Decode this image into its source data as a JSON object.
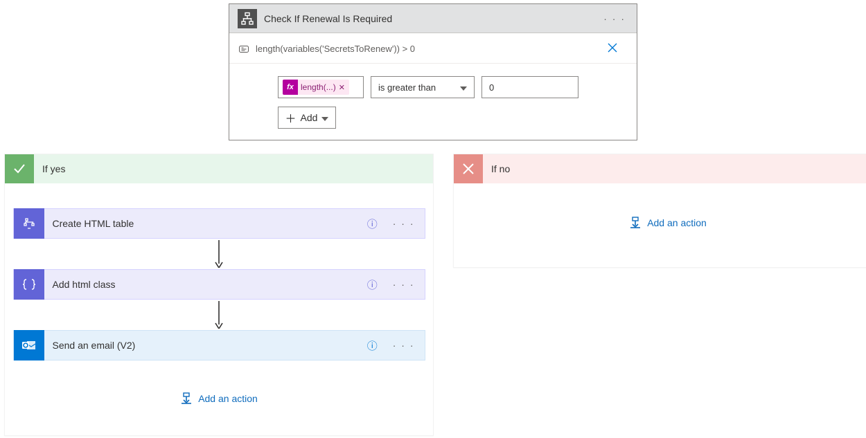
{
  "condition": {
    "title": "Check If Renewal Is Required",
    "expression_summary": "length(variables('SecretsToRenew')) > 0",
    "token_label": "length(...)",
    "operator": "is greater than",
    "value": "0",
    "add_label": "Add"
  },
  "branches": {
    "yes": {
      "label": "If yes",
      "actions": [
        {
          "id": "create-html-table",
          "title": "Create HTML table",
          "type": "dataops"
        },
        {
          "id": "add-html-class",
          "title": "Add html class",
          "type": "dataops"
        },
        {
          "id": "send-email-v2",
          "title": "Send an email (V2)",
          "type": "outlook"
        }
      ],
      "add_action_label": "Add an action"
    },
    "no": {
      "label": "If no",
      "add_action_label": "Add an action"
    }
  }
}
